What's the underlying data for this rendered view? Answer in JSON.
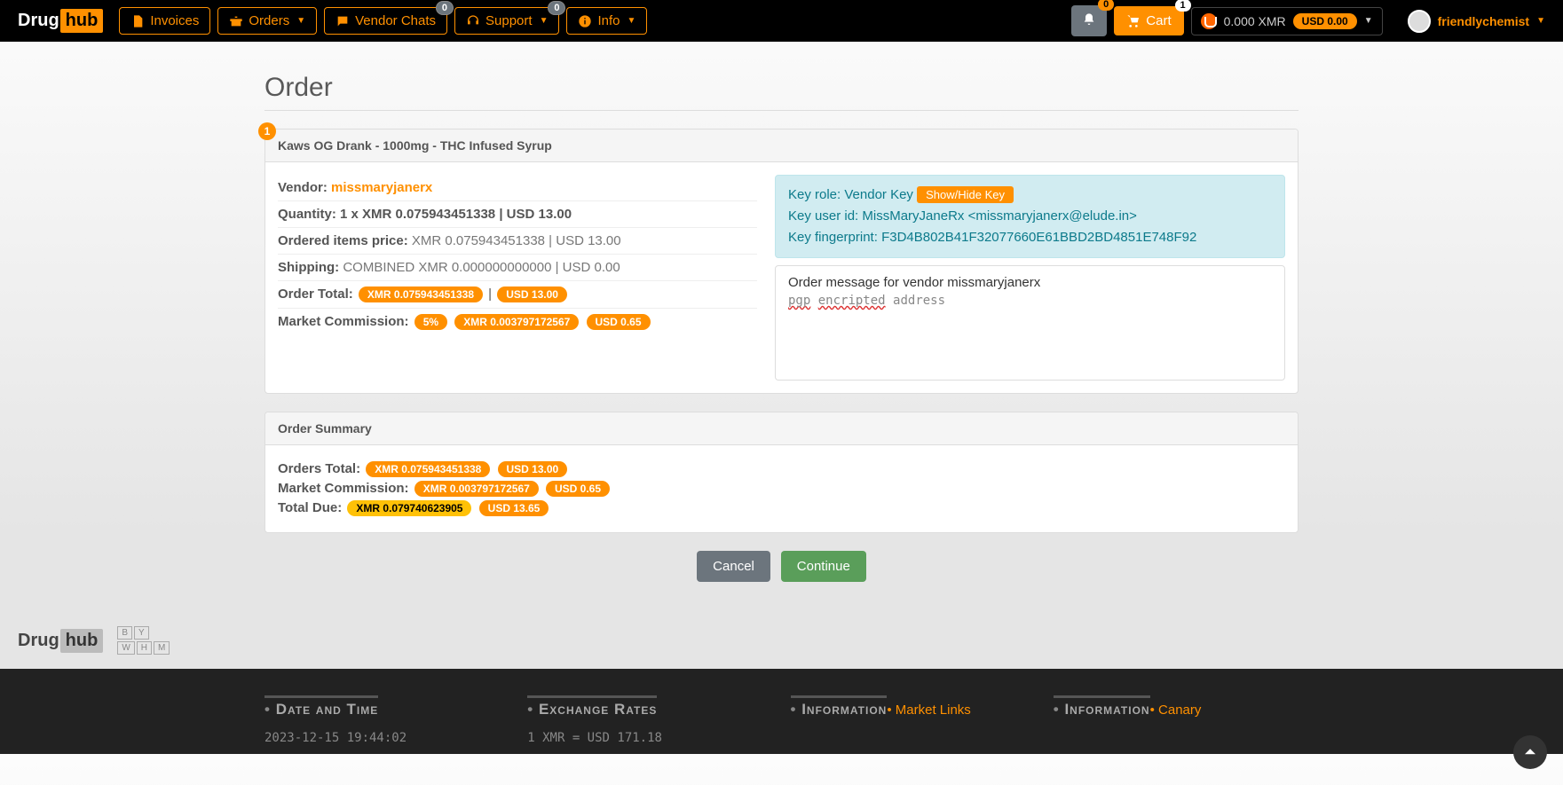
{
  "brand": {
    "a": "Drug",
    "b": "hub"
  },
  "nav": {
    "invoices": "Invoices",
    "orders": "Orders",
    "vendor_chats": "Vendor Chats",
    "vendor_chats_badge": "0",
    "support": "Support",
    "support_badge": "0",
    "info": "Info",
    "bell_badge": "0",
    "cart": "Cart",
    "cart_badge": "1",
    "balance_xmr": "0.000 XMR",
    "balance_usd": "USD 0.00",
    "username": "friendlychemist"
  },
  "page_title": "Order",
  "order": {
    "num": "1",
    "title": "Kaws OG Drank - 1000mg - THC Infused Syrup",
    "vendor_label": "Vendor:",
    "vendor": "missmaryjanerx",
    "qty_label": "Quantity:",
    "qty": "1 x XMR 0.075943451338 | USD 13.00",
    "items_label": "Ordered items price:",
    "items": "XMR 0.075943451338 | USD 13.00",
    "ship_label": "Shipping:",
    "ship": "COMBINED XMR 0.000000000000 | USD 0.00",
    "total_label": "Order Total:",
    "total_xmr": "XMR 0.075943451338",
    "total_usd": "USD 13.00",
    "comm_label": "Market Commission:",
    "comm_pct": "5%",
    "comm_xmr": "XMR 0.003797172567",
    "comm_usd": "USD 0.65",
    "key_role_label": "Key role:",
    "key_role": "Vendor Key",
    "key_btn": "Show/Hide Key",
    "key_user_label": "Key user id:",
    "key_user": "MissMaryJaneRx <missmaryjanerx@elude.in>",
    "key_fp_label": "Key fingerprint:",
    "key_fp": "F3D4B802B41F32077660E61BBD2BD4851E748F92",
    "msg_hdr": "Order message for vendor missmaryjanerx",
    "msg_enc1": "pgp",
    "msg_enc2": "encripted",
    "msg_enc3": "address"
  },
  "summary": {
    "title": "Order Summary",
    "orders_label": "Orders Total:",
    "orders_xmr": "XMR 0.075943451338",
    "orders_usd": "USD 13.00",
    "comm_label": "Market Commission:",
    "comm_xmr": "XMR 0.003797172567",
    "comm_usd": "USD 0.65",
    "due_label": "Total Due:",
    "due_xmr": "XMR 0.079740623905",
    "due_usd": "USD 13.65"
  },
  "actions": {
    "cancel": "Cancel",
    "continue": "Continue"
  },
  "footer": {
    "whm": {
      "b": "B",
      "y": "Y",
      "w": "W",
      "h": "H",
      "m": "M"
    },
    "col1_h": "Date and Time",
    "col1_v": "2023-12-15 19:44:02",
    "col2_h": "Exchange Rates",
    "col2_v": "1 XMR = USD 171.18",
    "col3_h": "Information",
    "col3_l": "Market Links",
    "col4_h": "Information",
    "col4_l": "Canary"
  }
}
